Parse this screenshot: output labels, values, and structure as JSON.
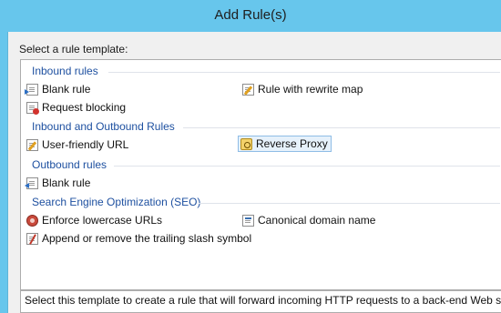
{
  "window": {
    "title": "Add Rule(s)"
  },
  "prompt": "Select a rule template:",
  "groups": [
    {
      "label": "Inbound rules",
      "items": [
        {
          "label": "Blank rule",
          "icon": "blank-rule-icon"
        },
        {
          "label": "Rule with rewrite map",
          "icon": "rewrite-map-icon"
        },
        {
          "label": "Request blocking",
          "icon": "request-blocking-icon"
        }
      ]
    },
    {
      "label": "Inbound and Outbound Rules",
      "items": [
        {
          "label": "User-friendly URL",
          "icon": "user-friendly-url-icon"
        },
        {
          "label": "Reverse Proxy",
          "icon": "reverse-proxy-icon",
          "selected": true
        }
      ]
    },
    {
      "label": "Outbound rules",
      "items": [
        {
          "label": "Blank rule",
          "icon": "outbound-blank-rule-icon"
        }
      ]
    },
    {
      "label": "Search Engine Optimization (SEO)",
      "items": [
        {
          "label": "Enforce lowercase URLs",
          "icon": "lowercase-urls-icon"
        },
        {
          "label": "Canonical domain name",
          "icon": "canonical-domain-icon"
        },
        {
          "label": "Append or remove the trailing slash symbol",
          "icon": "trailing-slash-icon"
        }
      ]
    }
  ],
  "description": "Select this template to create a rule that will forward incoming HTTP requests to a back-end Web server.",
  "colors": {
    "titlebar": "#67c6ec",
    "group_header": "#1e50a0",
    "selection": "#e6f1fb"
  }
}
